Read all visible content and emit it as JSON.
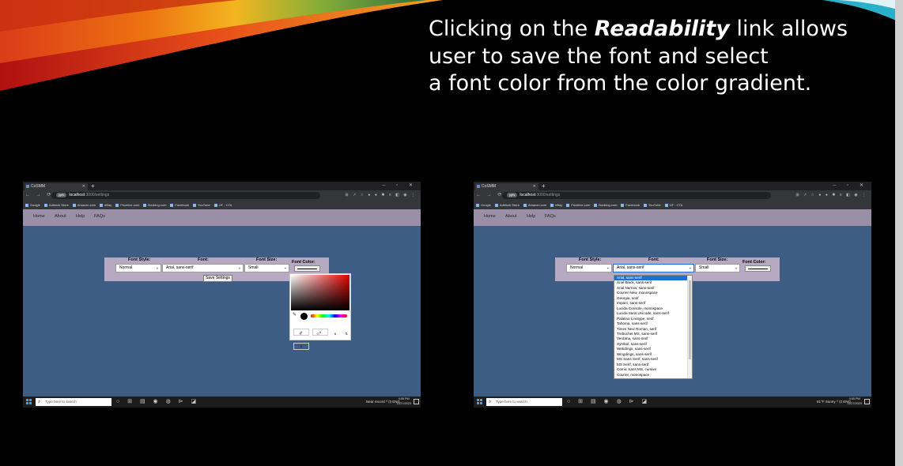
{
  "slide": {
    "line1_pre": "Clicking on the ",
    "line1_bold": "Readability",
    "line1_post": " link allows",
    "line2": "user to save the font and select",
    "line3": "a font color from the color gradient."
  },
  "browser": {
    "tab_title": "CoSMM",
    "new_tab": "+",
    "window_controls": "─ ▫ ✕",
    "nav_buttons": "← → ⟳",
    "url_pill": "ypfs",
    "url_host": "localhost",
    "url_path": ":3000/settings",
    "ext_icons": "⊞ ↗ ☆ ● ● ✱ ≡ ◧ ◉ ⋮",
    "bookmarks": [
      "Google",
      "Adblock Store",
      "Amazon.com",
      "eBay",
      "Priceline.com",
      "Booking.com",
      "Facebook",
      "YouTube",
      "UF - CTA"
    ]
  },
  "nav": {
    "home": "Home",
    "about": "About",
    "help": "Help",
    "faqs": "FAQs"
  },
  "settings": {
    "font_style_label": "Font Style:",
    "font_label": "Font:",
    "font_size_label": "Font Size:",
    "font_color_label": "Font Color:",
    "font_style_value": "Normal",
    "font_value": "Arial, sans-serif",
    "font_size_value": "Small",
    "save_button": "Save Settings"
  },
  "color_picker": {
    "r": "0",
    "g": "0",
    "b": "0",
    "r_label": "R",
    "g_label": "G",
    "b_label": "B",
    "arrows": "⇅"
  },
  "font_options": [
    "Arial, sans-serif",
    "Arial Black, sans-serif",
    "Arial Narrow, sans-serif",
    "Courier New, monospace",
    "Georgia, serif",
    "Impact, sans-serif",
    "Lucida Console, monospace",
    "Lucida Sans Unicode, sans-serif",
    "Palatino Linotype, serif",
    "Tahoma, sans-serif",
    "Times New Roman, serif",
    "Trebuchet MS, sans-serif",
    "Verdana, sans-serif",
    "Symbol, sans-serif",
    "Webdings, sans-serif",
    "Wingdings, sans-serif",
    "MS Sans Serif, sans-serif",
    "MS Serif, sans-serif",
    "Comic Sans MS, cursive",
    "Courier, monospace"
  ],
  "taskbar": {
    "search_placeholder": "Type here to search",
    "left_tray": "Near record  ^  ⊡  ENG",
    "right_tray": "61°F Sunny  ^  ⊡  ENG",
    "time": "4:55 PM",
    "date": "11/27/2023"
  }
}
